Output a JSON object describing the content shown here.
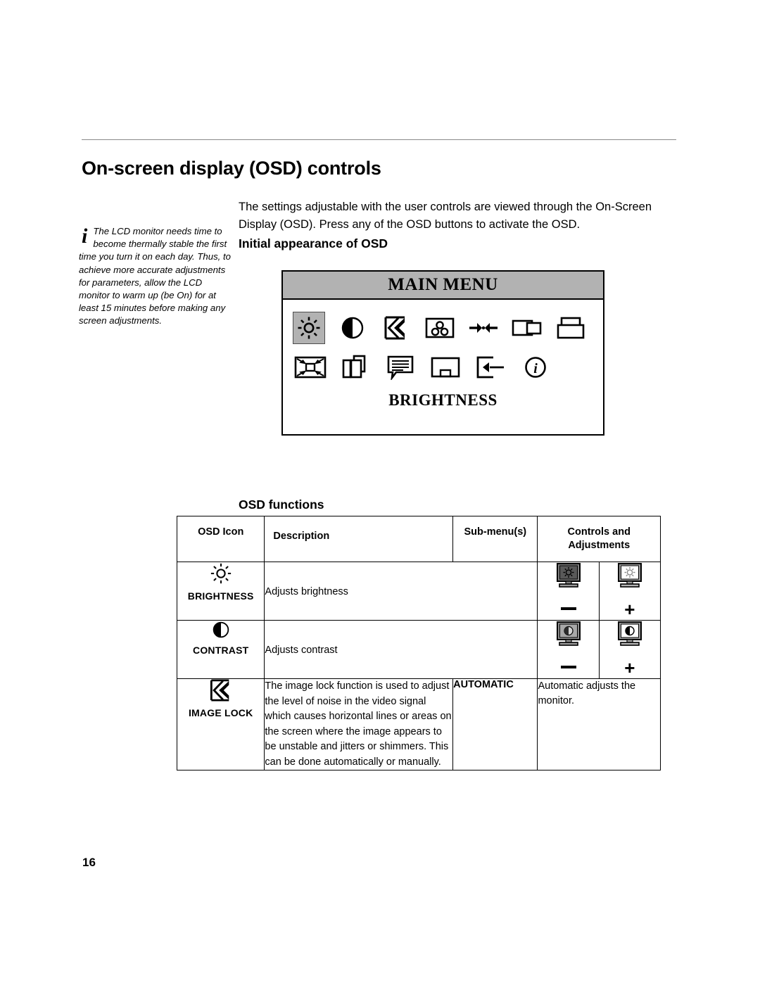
{
  "page": {
    "title": "On-screen display (OSD) controls",
    "page_number": "16"
  },
  "intro": {
    "paragraph": "The settings adjustable with the user controls are viewed through the On-Screen Display (OSD). Press any of the OSD buttons to activate the OSD."
  },
  "note": {
    "icon": "info-italic-i-icon",
    "text": "The LCD monitor needs time to become thermally stable the first time you turn it on each day. Thus, to achieve more accurate adjustments for parameters, allow the LCD monitor to warm up (be On) for at least 15 minutes before making any screen adjustments."
  },
  "sections": {
    "initial_appearance": "Initial appearance of OSD",
    "osd_functions": "OSD functions"
  },
  "osd_menu": {
    "title": "MAIN MENU",
    "selected_label": "BRIGHTNESS",
    "header_bg": "#b2b2b2",
    "row1_icons": [
      {
        "name": "brightness-sun-icon",
        "selected": true
      },
      {
        "name": "contrast-half-circle-icon",
        "selected": false
      },
      {
        "name": "image-lock-chevron-icon",
        "selected": false
      },
      {
        "name": "color-three-circles-icon",
        "selected": false
      },
      {
        "name": "horizontal-position-arrows-icon",
        "selected": false
      },
      {
        "name": "horizontal-size-rectangles-icon",
        "selected": false
      },
      {
        "name": "vertical-size-rectangles-icon",
        "selected": false
      }
    ],
    "row2_icons": [
      {
        "name": "scaling-corner-arrows-icon",
        "selected": false
      },
      {
        "name": "input-pages-icon",
        "selected": false
      },
      {
        "name": "osd-language-bubble-icon",
        "selected": false
      },
      {
        "name": "osd-position-icon",
        "selected": false
      },
      {
        "name": "factory-reset-arrow-icon",
        "selected": false
      },
      {
        "name": "information-i-circle-icon",
        "selected": false
      }
    ]
  },
  "table": {
    "headers": {
      "icon": "OSD Icon",
      "description": "Description",
      "submenu": "Sub-menu(s)",
      "controls_line1": "Controls and",
      "controls_line2": "Adjustments"
    },
    "rows": [
      {
        "icon_name": "brightness-sun-icon",
        "icon_label": "BRIGHTNESS",
        "description": "Adjusts brightness",
        "submenu": "",
        "submenu_description": "",
        "control_decrease_icon": "monitor-dark-brightness-icon",
        "control_decrease_sign": "minus",
        "control_increase_icon": "monitor-light-brightness-icon",
        "control_increase_sign": "+"
      },
      {
        "icon_name": "contrast-half-circle-icon",
        "icon_label": "CONTRAST",
        "description": "Adjusts contrast",
        "submenu": "",
        "submenu_description": "",
        "control_decrease_icon": "monitor-low-contrast-icon",
        "control_decrease_sign": "minus",
        "control_increase_icon": "monitor-high-contrast-icon",
        "control_increase_sign": "+"
      },
      {
        "icon_name": "image-lock-chevron-icon",
        "icon_label": "IMAGE LOCK",
        "description": "The image lock function is used to adjust the level of noise in the video signal which causes horizontal lines or areas on the screen where the image appears to be unstable and jitters or shimmers. This can be done automatically or manually.",
        "submenu": "AUTOMATIC",
        "submenu_description": "Automatic adjusts the monitor.",
        "control_decrease_icon": "",
        "control_decrease_sign": "",
        "control_increase_icon": "",
        "control_increase_sign": ""
      }
    ]
  }
}
